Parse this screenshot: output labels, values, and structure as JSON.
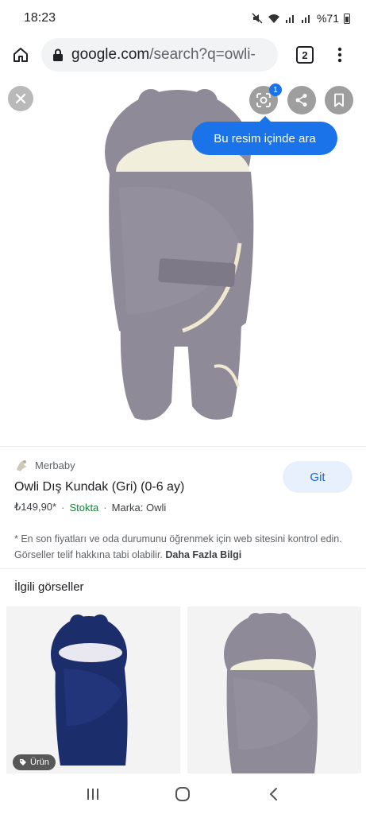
{
  "status": {
    "time": "18:23",
    "battery": "%71"
  },
  "browser": {
    "url_domain": "google.com",
    "url_path": "/search?q=owli-",
    "tab_count": "2"
  },
  "viewer": {
    "lens_badge": "1",
    "tooltip": "Bu resim içinde ara"
  },
  "result": {
    "source": "Merbaby",
    "title": "Owli Dış Kundak (Gri) (0-6 ay)",
    "price": "₺149,90*",
    "stock": "Stokta",
    "brand": "Marka: Owli",
    "visit_button": "Git"
  },
  "disclaimer": {
    "text": "* En son fiyatları ve oda durumunu öğrenmek için web sitesini kontrol edin. Görseller telif hakkına tabi olabilir.",
    "link": "Daha Fazla Bilgi"
  },
  "related": {
    "title": "İlgili görseller",
    "badge": "Ürün"
  },
  "colors": {
    "accent": "#1a73e8",
    "stock_green": "#188038",
    "product_gray": "#8e8a97",
    "product_navy": "#1c2d6b"
  }
}
